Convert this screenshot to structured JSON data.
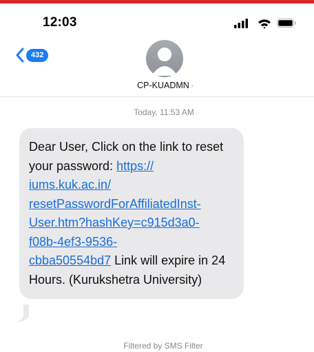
{
  "status_bar": {
    "time": "12:03"
  },
  "header": {
    "back_badge": "432",
    "contact_name": "CP-KUADMN",
    "contact_chevron": "›"
  },
  "conversation": {
    "date_label": "Today,",
    "time_label": "11:53 AM",
    "message": {
      "text_before_link": "Dear User, Click on the link to reset your password: ",
      "link_line1": "https://",
      "link_line2": "iums.kuk.ac.in/",
      "link_line3": "resetPasswordForAffiliatedInst-",
      "link_line4": "User.htm?hashKey=c915d3a0-",
      "link_line5": "f08b-4ef3-9536-",
      "link_line6": "cbba50554bd7",
      "text_after_link": " Link will expire in 24 Hours. (Kurukshetra University)"
    },
    "filter_note": "Filtered by SMS Filter"
  },
  "icons": {
    "signal": "signal-bars-icon",
    "wifi": "wifi-icon",
    "battery": "battery-icon",
    "back": "chevron-left-icon",
    "avatar": "person-icon"
  },
  "colors": {
    "top_bar": "#d8262b",
    "link": "#1a6fd9",
    "badge": "#1a7cf6",
    "bubble": "#e9e9eb"
  }
}
